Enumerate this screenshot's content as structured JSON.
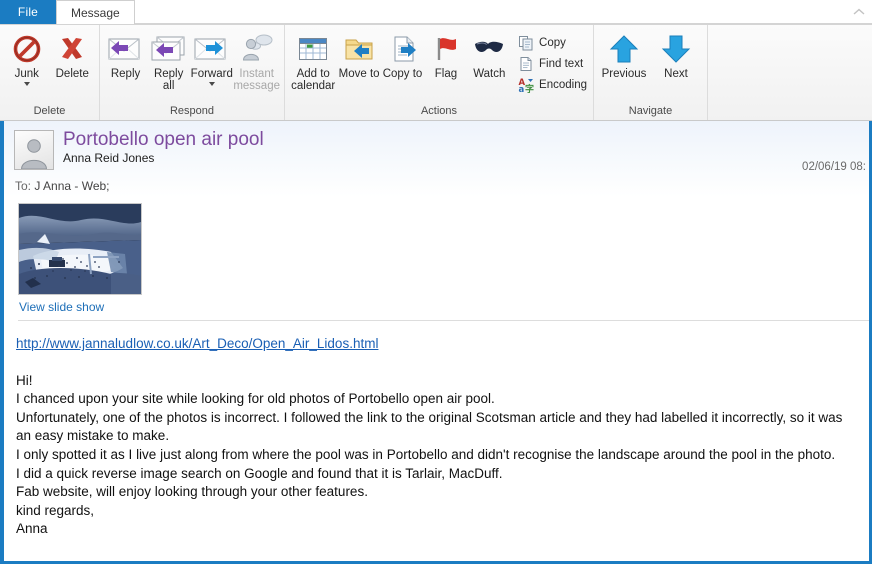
{
  "window": {
    "tabs": [
      {
        "id": "file",
        "label": "File"
      },
      {
        "id": "message",
        "label": "Message"
      }
    ],
    "collapse_ribbon_icon": "chevron-up-icon",
    "file_tab_color": "#1b7cc2",
    "pane_border_color": "#1b7cc2"
  },
  "ribbon": {
    "groups": [
      {
        "name": "delete",
        "label": "Delete",
        "buttons": [
          {
            "id": "junk",
            "label": "Junk",
            "icon": "no-entry-icon",
            "has_caret": true,
            "disabled": false
          },
          {
            "id": "delete",
            "label": "Delete",
            "icon": "red-x-icon",
            "has_caret": false,
            "disabled": false
          }
        ]
      },
      {
        "name": "respond",
        "label": "Respond",
        "buttons": [
          {
            "id": "reply",
            "label": "Reply",
            "icon": "reply-envelope-icon",
            "has_caret": false,
            "disabled": false
          },
          {
            "id": "reply-all",
            "label": "Reply all",
            "icon": "reply-all-envelope-icon",
            "has_caret": false,
            "disabled": false
          },
          {
            "id": "forward",
            "label": "Forward",
            "icon": "forward-envelope-icon",
            "has_caret": true,
            "disabled": false
          },
          {
            "id": "instant-message",
            "label": "Instant message",
            "icon": "instant-message-icon",
            "has_caret": false,
            "disabled": true
          }
        ]
      },
      {
        "name": "actions",
        "label": "Actions",
        "buttons": [
          {
            "id": "add-to-calendar",
            "label": "Add to calendar",
            "icon": "calendar-icon",
            "has_caret": false,
            "disabled": false
          },
          {
            "id": "move-to",
            "label": "Move to",
            "icon": "folder-move-icon",
            "has_caret": false,
            "disabled": false
          },
          {
            "id": "copy-to",
            "label": "Copy to",
            "icon": "copy-document-icon",
            "has_caret": false,
            "disabled": false
          },
          {
            "id": "flag",
            "label": "Flag",
            "icon": "red-flag-icon",
            "has_caret": false,
            "disabled": false
          },
          {
            "id": "watch",
            "label": "Watch",
            "icon": "sunglasses-icon",
            "has_caret": false,
            "disabled": false
          }
        ],
        "list_items": [
          {
            "id": "copy",
            "label": "Copy",
            "icon": "copy-icon"
          },
          {
            "id": "find-text",
            "label": "Find text",
            "icon": "document-icon"
          },
          {
            "id": "encoding",
            "label": "Encoding",
            "icon": "encoding-icon"
          }
        ]
      },
      {
        "name": "navigate",
        "label": "Navigate",
        "buttons": [
          {
            "id": "previous",
            "label": "Previous",
            "icon": "arrow-up-icon",
            "has_caret": false,
            "disabled": false
          },
          {
            "id": "next",
            "label": "Next",
            "icon": "arrow-down-icon",
            "has_caret": false,
            "disabled": false
          }
        ]
      }
    ]
  },
  "message": {
    "subject": "Portobello open air pool",
    "sender": "Anna Reid Jones",
    "date": "02/06/19 08:",
    "to_label": "To:",
    "to_value": "J Anna - Web;",
    "avatar_icon": "contact-person-icon",
    "attachment": {
      "slideshow_link": "View slide show",
      "thumbnail_alt": "aerial-photo-open-air-pool"
    },
    "body": {
      "link": "http://www.jannaludlow.co.uk/Art_Deco/Open_Air_Lidos.html",
      "lines": [
        "Hi!",
        "I chanced upon your site while looking for old photos of Portobello open air pool.",
        "Unfortunately, one of the photos is incorrect. I followed the link to the original Scotsman article and they had labelled it incorrectly, so it was an easy mistake to make.",
        "I only spotted it as I live just along from where the pool was in Portobello and didn't recognise the landscape around the pool in the photo.",
        "I did a quick reverse image search on Google and found that it is Tarlair, MacDuff.",
        "Fab website, will enjoy looking through your other features.",
        "kind regards,",
        "Anna"
      ]
    }
  }
}
